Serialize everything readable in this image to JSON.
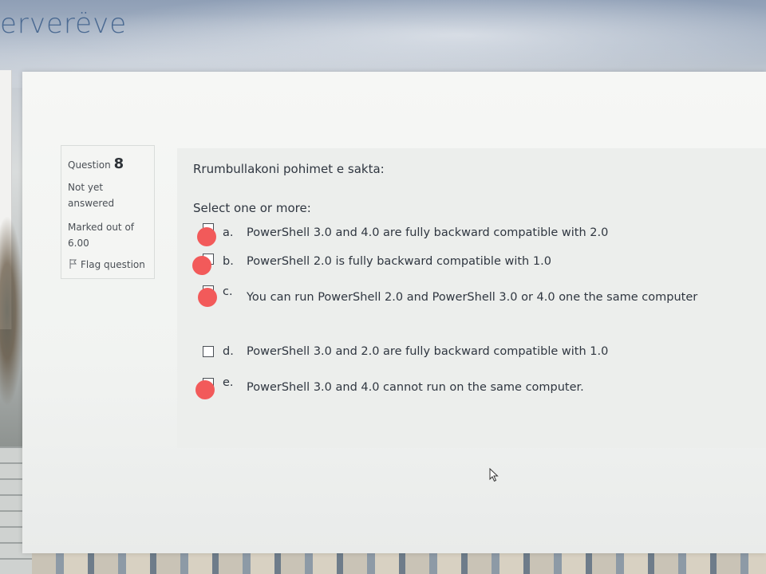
{
  "background": {
    "site_title_fragment": "erverëve"
  },
  "info": {
    "question_label": "Question",
    "question_number": "8",
    "state_line1": "Not yet",
    "state_line2": "answered",
    "marks_line1": "Marked out of",
    "marks_line2": "6.00",
    "flag_label": "Flag question"
  },
  "question": {
    "text": "Rrumbullakoni pohimet e sakta:",
    "prompt": "Select one or more:",
    "options": [
      {
        "letter": "a.",
        "text": "PowerShell 3.0 and 4.0 are fully backward compatible with 2.0",
        "marked": true
      },
      {
        "letter": "b.",
        "text": "PowerShell 2.0 is fully backward compatible with 1.0",
        "marked": true
      },
      {
        "letter": "c.",
        "text": "You can run PowerShell 2.0 and PowerShell 3.0 or 4.0 one the same computer",
        "marked": true
      },
      {
        "letter": "d.",
        "text": "PowerShell 3.0 and 2.0 are fully backward compatible with 1.0",
        "marked": false
      },
      {
        "letter": "e.",
        "text": "PowerShell 3.0 and 4.0 cannot run on the same computer.",
        "marked": true
      }
    ]
  },
  "colors": {
    "marker": "#f25a5a",
    "text": "#2f3640"
  },
  "icons": {
    "flag": "flag-icon",
    "cursor": "mouse-cursor-icon"
  }
}
